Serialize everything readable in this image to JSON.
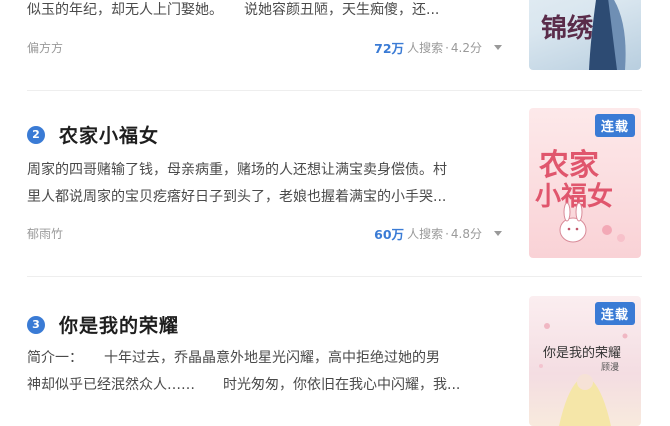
{
  "items": [
    {
      "desc_lines": [
        "似玉的年纪，却无人上门娶她。　　说她容颜丑陋，天生痴傻，还..."
      ],
      "author": "偏方方",
      "count": "72万",
      "searchers_label": "人搜索",
      "score": "4.2分",
      "dot": "·",
      "cover_text": "锦绣"
    },
    {
      "rank": "2",
      "title": "农家小福女",
      "desc_lines": [
        "周家的四哥赌输了钱，母亲病重，赌场的人还想让满宝卖身偿债。村",
        "里人都说周家的宝贝疙瘩好日子到头了，老娘也握着满宝的小手哭..."
      ],
      "author": "郁雨竹",
      "count": "60万",
      "searchers_label": "人搜索",
      "score": "4.8分",
      "dot": "·",
      "badge": "连载",
      "cover_text_1": "农家",
      "cover_text_2": "小福女"
    },
    {
      "rank": "3",
      "title": "你是我的荣耀",
      "desc_lines": [
        "简介一：　　十年过去，乔晶晶意外地星光闪耀，高中拒绝过她的男",
        "神却似乎已经泯然众人……　　时光匆匆，你依旧在我心中闪耀，我..."
      ],
      "badge": "连载",
      "cover_text_1": "你是我的荣耀",
      "cover_text_2": "顾漫"
    }
  ],
  "colors": {
    "accent": "#3a7bd5",
    "text": "#222222",
    "muted": "#9a9a9a"
  }
}
